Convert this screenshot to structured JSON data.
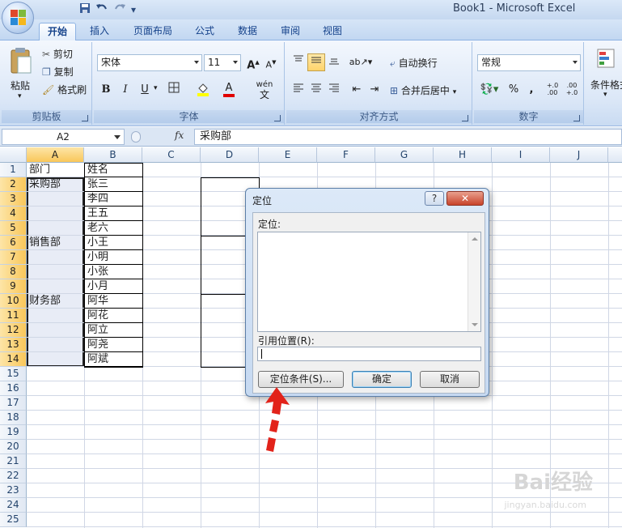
{
  "window": {
    "title": "Book1 - Microsoft Excel"
  },
  "qat": {
    "save_icon": "save-icon",
    "undo_icon": "undo-icon",
    "redo_icon": "redo-icon"
  },
  "tabs": [
    {
      "label": "开始",
      "active": true
    },
    {
      "label": "插入"
    },
    {
      "label": "页面布局"
    },
    {
      "label": "公式"
    },
    {
      "label": "数据"
    },
    {
      "label": "审阅"
    },
    {
      "label": "视图"
    }
  ],
  "ribbon": {
    "clipboard": {
      "paste": "粘贴",
      "cut": "剪切",
      "copy": "复制",
      "format_painter": "格式刷",
      "group": "剪贴板"
    },
    "font": {
      "name": "宋体",
      "size": "11",
      "bold": "B",
      "italic": "I",
      "underline": "U",
      "group": "字体",
      "wen": "wén"
    },
    "alignment": {
      "wrap": "自动换行",
      "merge": "合并后居中",
      "group": "对齐方式"
    },
    "number": {
      "format": "常规",
      "percent": "%",
      "comma": ",",
      "group": "数字",
      "dec_inc": "+.0\n.00",
      "dec_dec": ".00\n+.0"
    },
    "styles": {
      "cond_format": "条件格式"
    }
  },
  "formula_bar": {
    "name_box": "A2",
    "fx": "fx",
    "content": "采购部"
  },
  "grid": {
    "columns": [
      "A",
      "B",
      "C",
      "D",
      "E",
      "F",
      "G",
      "H",
      "I",
      "J"
    ],
    "rows": [
      "1",
      "2",
      "3",
      "4",
      "5",
      "6",
      "7",
      "8",
      "9",
      "10",
      "11",
      "12",
      "13",
      "14",
      "15",
      "16",
      "17",
      "18",
      "19",
      "20",
      "21",
      "22",
      "23",
      "24",
      "25"
    ],
    "col_a": [
      "部门",
      "采购部",
      "",
      "",
      "",
      "销售部",
      "",
      "",
      "",
      "财务部",
      "",
      "",
      "",
      ""
    ],
    "col_b": [
      "姓名",
      "张三",
      "李四",
      "王五",
      "老六",
      "小王",
      "小明",
      "小张",
      "小月",
      "阿华",
      "阿花",
      "阿立",
      "阿尧",
      "阿斌"
    ]
  },
  "dialog": {
    "title": "定位",
    "help": "?",
    "close": "✕",
    "goto_label": "定位:",
    "ref_label": "引用位置(R):",
    "special_button": "定位条件(S)...",
    "ok_button": "确定",
    "cancel_button": "取消"
  },
  "watermark": {
    "brand": "Bai经验",
    "url": "jingyan.baidu.com"
  }
}
